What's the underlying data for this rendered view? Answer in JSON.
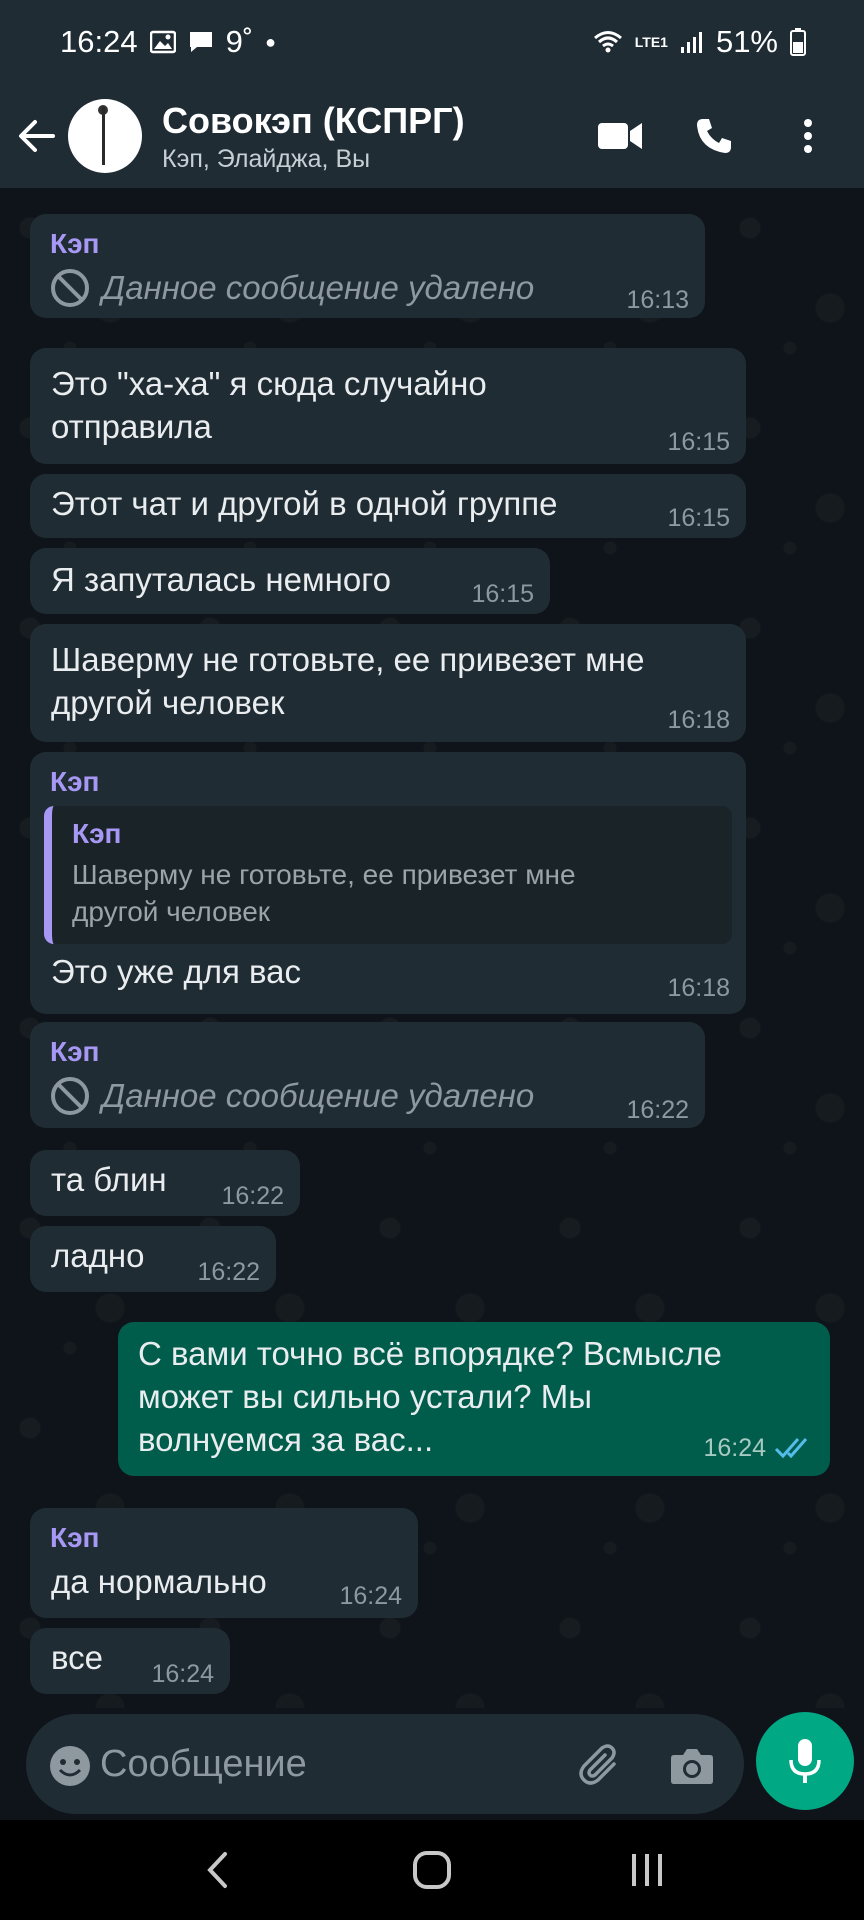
{
  "status_bar": {
    "time": "16:24",
    "temperature": "9˚",
    "battery": "51%",
    "network": "LTE1"
  },
  "header": {
    "title": "Совокэп (КСПРГ)",
    "subtitle": "Кэп, Элайджа, Вы"
  },
  "messages": [
    {
      "sender": "Кэп",
      "deleted_text": "Данное сообщение удалено",
      "time": "16:13"
    },
    {
      "lines": [
        "Это \"ха-ха\" я сюда случайно",
        "отправила"
      ],
      "time": "16:15"
    },
    {
      "lines": [
        "Этот чат и другой в одной группе"
      ],
      "time": "16:15"
    },
    {
      "lines": [
        "Я запуталась немного"
      ],
      "time": "16:15"
    },
    {
      "lines": [
        "Шаверму не готовьте, ее привезет мне",
        "другой человек"
      ],
      "time": "16:18"
    },
    {
      "sender": "Кэп",
      "quote_author": "Кэп",
      "quote_lines": [
        "Шаверму не готовьте, ее привезет мне",
        "другой человек"
      ],
      "lines": [
        "Это уже для вас"
      ],
      "time": "16:18"
    },
    {
      "sender": "Кэп",
      "deleted_text": "Данное сообщение удалено",
      "time": "16:22"
    },
    {
      "lines": [
        "та блин"
      ],
      "time": "16:22"
    },
    {
      "lines": [
        "ладно"
      ],
      "time": "16:22"
    },
    {
      "outgoing": true,
      "lines": [
        "С вами точно всё впорядке? Всмысле",
        "может  вы сильно устали? Мы",
        "волнуемся за вас..."
      ],
      "time": "16:24",
      "status": "read"
    },
    {
      "sender": "Кэп",
      "lines": [
        "да нормально"
      ],
      "time": "16:24"
    },
    {
      "lines": [
        "все"
      ],
      "time": "16:24"
    }
  ],
  "composer": {
    "placeholder": "Сообщение"
  },
  "colors": {
    "header_bg": "#1f2c34",
    "incoming_bubble": "#202c33",
    "outgoing_bubble": "#005c4b",
    "sender_name": "#a898f5",
    "accent": "#00a884",
    "read_ticks": "#53bdeb"
  },
  "icons": {
    "back": "arrow-left-icon",
    "video": "video-camera-icon",
    "call": "phone-icon",
    "menu": "more-vertical-icon",
    "emoji": "emoji-icon",
    "attach": "paperclip-icon",
    "camera": "camera-icon",
    "mic": "microphone-icon",
    "deleted": "block-icon"
  }
}
